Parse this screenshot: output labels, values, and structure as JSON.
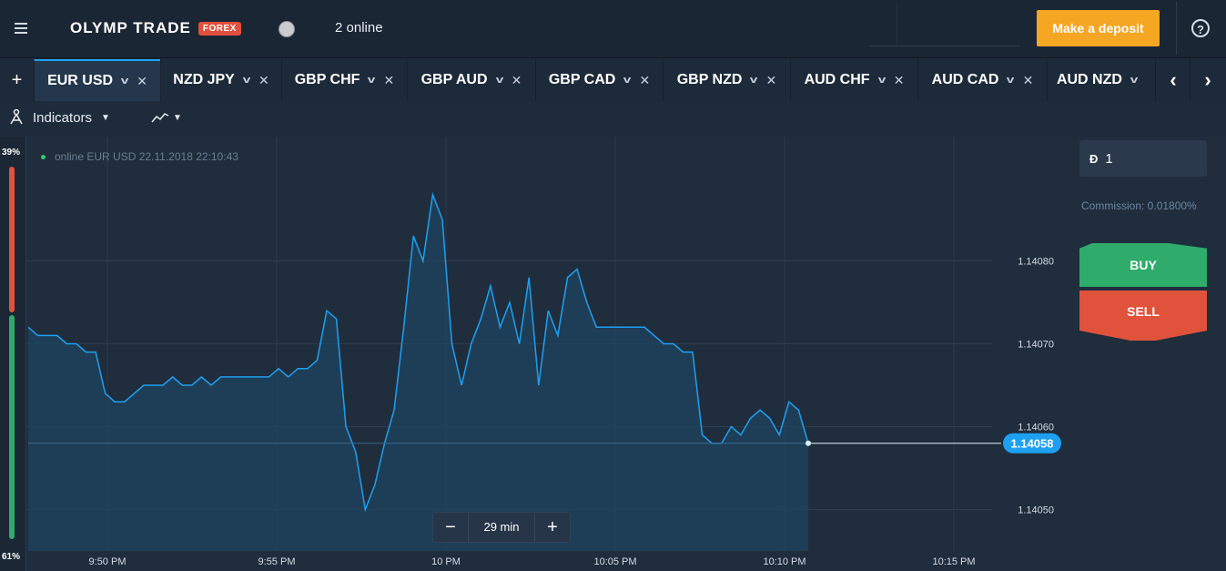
{
  "header": {
    "brand": "OLYMP TRADE",
    "badge": "FOREX",
    "status": "2 online",
    "deposit_label": "Make a deposit",
    "help_icon": "help-icon"
  },
  "tabs": {
    "add_icon": "+",
    "items": [
      {
        "label": "EUR USD",
        "active": true
      },
      {
        "label": "NZD JPY"
      },
      {
        "label": "GBP CHF"
      },
      {
        "label": "GBP AUD"
      },
      {
        "label": "GBP CAD"
      },
      {
        "label": "GBP NZD"
      },
      {
        "label": "AUD CHF"
      },
      {
        "label": "AUD CAD"
      },
      {
        "label": "AUD NZD"
      }
    ],
    "prev_icon": "‹",
    "next_icon": "›"
  },
  "toolbar": {
    "indicators_label": "Indicators"
  },
  "sentiment": {
    "top_pct": "39%",
    "bottom_pct": "61%",
    "colors": {
      "sell": "#e0523c",
      "buy": "#2fab6b"
    }
  },
  "chart_data": {
    "type": "area",
    "legend": "online EUR USD  22.11.2018 22:10:43",
    "current_price": "1.14058",
    "y_ticks": [
      "1.14080",
      "1.14070",
      "1.14060",
      "1.14050"
    ],
    "x_ticks": [
      "9:50 PM",
      "9:55 PM",
      "10 PM",
      "10:05 PM",
      "10:10 PM",
      "10:15 PM"
    ],
    "ylim": [
      1.14045,
      1.14095
    ],
    "series": [
      {
        "color": "#1ea0f0",
        "values": [
          1.14072,
          1.14071,
          1.14071,
          1.14071,
          1.1407,
          1.1407,
          1.14069,
          1.14069,
          1.14064,
          1.14063,
          1.14063,
          1.14064,
          1.14065,
          1.14065,
          1.14065,
          1.14066,
          1.14065,
          1.14065,
          1.14066,
          1.14065,
          1.14066,
          1.14066,
          1.14066,
          1.14066,
          1.14066,
          1.14066,
          1.14067,
          1.14066,
          1.14067,
          1.14067,
          1.14068,
          1.14074,
          1.14073,
          1.1406,
          1.14057,
          1.1405,
          1.14053,
          1.14058,
          1.14062,
          1.14072,
          1.14083,
          1.1408,
          1.14088,
          1.14085,
          1.1407,
          1.14065,
          1.1407,
          1.14073,
          1.14077,
          1.14072,
          1.14075,
          1.1407,
          1.14078,
          1.14065,
          1.14074,
          1.14071,
          1.14078,
          1.14079,
          1.14075,
          1.14072,
          1.14072,
          1.14072,
          1.14072,
          1.14072,
          1.14072,
          1.14071,
          1.1407,
          1.1407,
          1.14069,
          1.14069,
          1.14059,
          1.14058,
          1.14058,
          1.1406,
          1.14059,
          1.14061,
          1.14062,
          1.14061,
          1.14059,
          1.14063,
          1.14062,
          1.14058
        ]
      }
    ],
    "grid": true,
    "zoom_label": "29 min"
  },
  "trade_panel": {
    "currency_symbol": "Đ",
    "amount": "1",
    "commission": "Commission: 0.01800%",
    "buy_label": "BUY",
    "sell_label": "SELL"
  }
}
